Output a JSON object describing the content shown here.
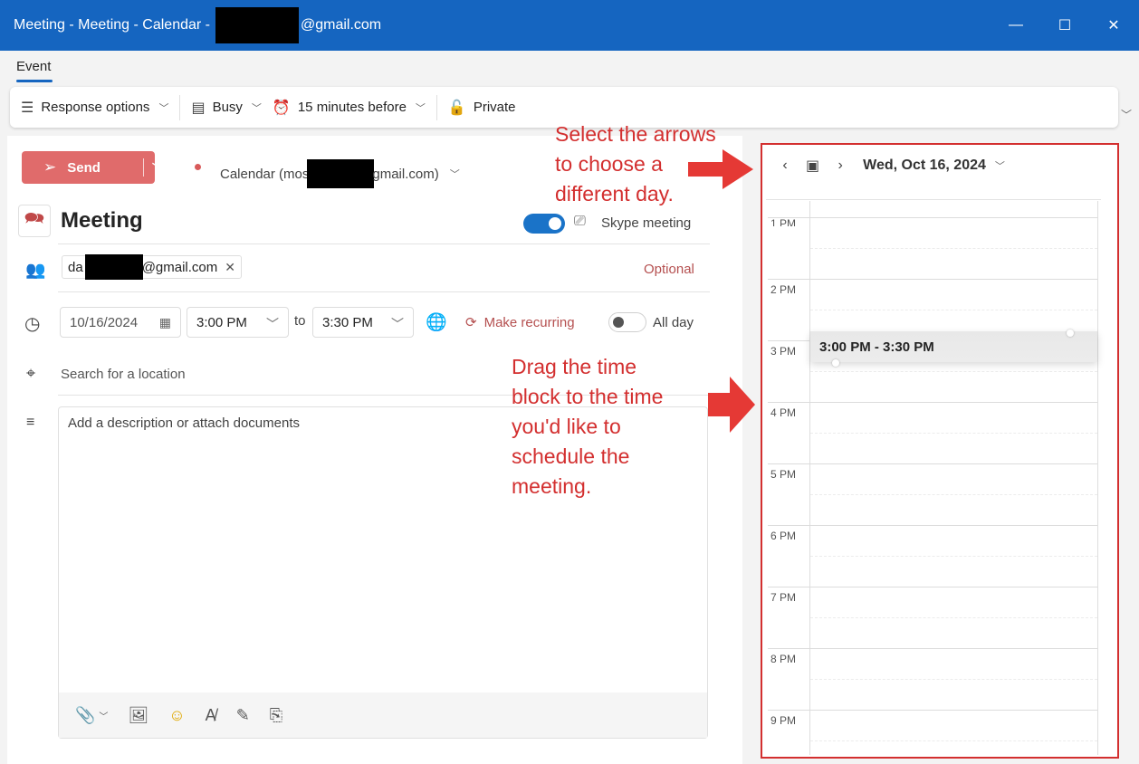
{
  "window": {
    "title_prefix": "Meeting - Meeting - Calendar -",
    "title_suffix": "@gmail.com",
    "minimize_glyph": "—",
    "maximize_glyph": "☐",
    "close_glyph": "✕"
  },
  "tabs": [
    {
      "label": "Event",
      "active": true
    }
  ],
  "ribbon": {
    "response_options": "Response options",
    "busy": "Busy",
    "reminder": "15 minutes before",
    "private": "Private"
  },
  "compose": {
    "send_label": "Send",
    "calendar_prefix": "Calendar (mos",
    "calendar_suffix": "gmail.com)",
    "title": "Meeting",
    "skype_label": "Skype meeting",
    "attendee_prefix": "da",
    "attendee_suffix": "@gmail.com",
    "optional_label": "Optional",
    "start_date": "10/16/2024",
    "start_time": "3:00 PM",
    "to_label": "to",
    "end_time": "3:30 PM",
    "make_recurring": "Make recurring",
    "all_day": "All day",
    "location_placeholder": "Search for a location",
    "description_placeholder": "Add a description or attach documents"
  },
  "day_view": {
    "date": "Wed, Oct 16, 2024",
    "hours": [
      "1 PM",
      "2 PM",
      "3 PM",
      "4 PM",
      "5 PM",
      "6 PM",
      "7 PM",
      "8 PM",
      "9 PM"
    ],
    "event_label": "3:00 PM - 3:30 PM"
  },
  "annotations": {
    "arrows_note": [
      "Select the arrows",
      "to choose a",
      "different day."
    ],
    "drag_note": [
      "Drag the time",
      "block to the time",
      "you'd like to",
      "schedule the",
      "meeting."
    ]
  },
  "colors": {
    "titlebar": "#1565c0",
    "send_button": "#e06b6b",
    "annotation": "#d32f2f",
    "toggle_on": "#1a73c8",
    "accent_text": "#b55050"
  },
  "icons": {
    "response_options": "sliders-icon",
    "busy": "busy-icon",
    "reminder": "alarm-clock-icon",
    "private": "lock-icon",
    "send": "paper-plane-icon",
    "meeting": "chat-icon",
    "skype": "video-camera-icon",
    "people": "people-add-icon",
    "clock": "clock-icon",
    "location": "location-pin-icon",
    "description": "text-lines-icon"
  }
}
